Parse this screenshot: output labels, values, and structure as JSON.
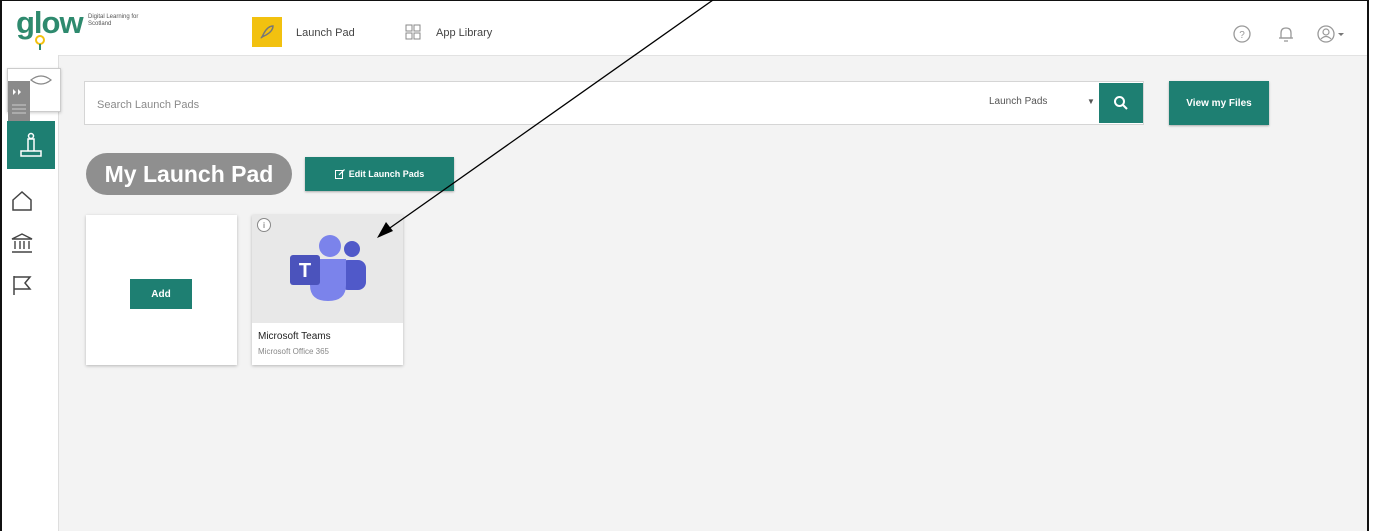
{
  "header": {
    "logo_text": "glow",
    "logo_tagline": "Digital Learning for Scotland",
    "launch_pad_label": "Launch Pad",
    "app_library_label": "App Library",
    "icons": [
      "help-icon",
      "bell-icon",
      "user-avatar-icon"
    ]
  },
  "sidebar": {
    "icons": [
      "expand-icon",
      "launchpad-icon",
      "home-icon",
      "institution-icon",
      "flag-icon"
    ]
  },
  "search": {
    "placeholder": "Search Launch Pads",
    "scope_label": "Launch Pads",
    "view_files_label": "View my Files"
  },
  "main": {
    "heading": "My Launch Pad",
    "edit_button_label": "Edit Launch Pads",
    "add_label": "Add",
    "tiles": [
      {
        "title": "Microsoft Teams",
        "subtitle": "Microsoft Office 365"
      }
    ]
  },
  "colors": {
    "accent": "#1e7f72",
    "highlight": "#f2c10f",
    "teams_purple": "#5059c9"
  }
}
